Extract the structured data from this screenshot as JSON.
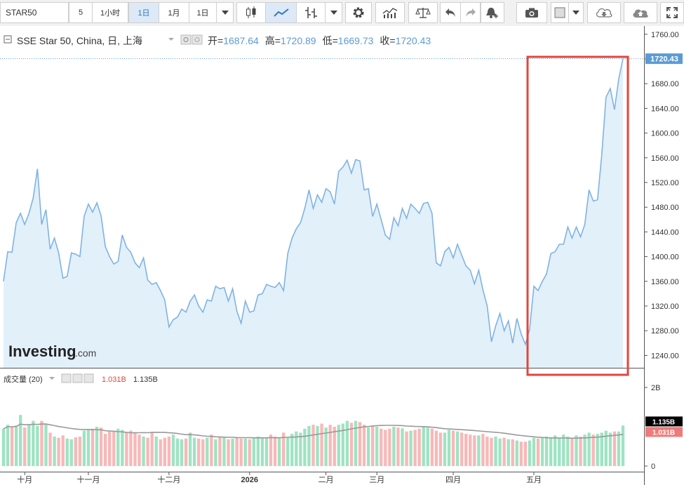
{
  "toolbar": {
    "symbol": "STAR50",
    "interval_value": "5",
    "interval_1h": "1小时",
    "interval_1d": "1日",
    "interval_1m": "1月",
    "range": "1日"
  },
  "legend": {
    "title": "SSE Star 50, China, 日, 上海",
    "open_label": "开=",
    "open_value": "1687.64",
    "high_label": "高=",
    "high_value": "1720.89",
    "low_label": "低=",
    "low_value": "1669.73",
    "close_label": "收=",
    "close_value": "1720.43"
  },
  "volume_legend": {
    "title": "成交量 (20)",
    "volume_value": "1.031B",
    "ma_value": "1.135B"
  },
  "watermark": {
    "brand": "Investing",
    "suffix": ".com"
  },
  "colors": {
    "line": "#7fb3e3",
    "area_fill": "#e2f0fa",
    "price_tag": "#5b9bd5",
    "up_volume": "#9fe3c3",
    "down_volume": "#f8b8b8",
    "ma_line": "#999999",
    "highlight_box": "#e0463e",
    "legend_value": "#5b9bd5"
  },
  "chart_data": {
    "type": "line",
    "title": "SSE Star 50, China, 日, 上海",
    "ylim": [
      1220,
      1770
    ],
    "yticks": [
      "1760.00",
      "1720.00",
      "1680.00",
      "1640.00",
      "1600.00",
      "1560.00",
      "1520.00",
      "1480.00",
      "1440.00",
      "1400.00",
      "1360.00",
      "1320.00",
      "1280.00",
      "1240.00"
    ],
    "ytick_values": [
      1760,
      1720,
      1680,
      1640,
      1600,
      1560,
      1520,
      1480,
      1440,
      1400,
      1360,
      1320,
      1280,
      1240
    ],
    "current_price_label": "1720.43",
    "current_price": 1720.43,
    "xticks": [
      {
        "label": "十月",
        "index": 5
      },
      {
        "label": "十一月",
        "index": 20
      },
      {
        "label": "十二月",
        "index": 39
      },
      {
        "label": "2026",
        "index": 58
      },
      {
        "label": "二月",
        "index": 76
      },
      {
        "label": "三月",
        "index": 88
      },
      {
        "label": "四月",
        "index": 106
      },
      {
        "label": "五月",
        "index": 125
      }
    ],
    "close": [
      1360,
      1408,
      1407,
      1455,
      1470,
      1452,
      1470,
      1495,
      1542,
      1452,
      1476,
      1412,
      1430,
      1406,
      1365,
      1368,
      1406,
      1404,
      1400,
      1465,
      1485,
      1472,
      1487,
      1466,
      1416,
      1400,
      1388,
      1392,
      1435,
      1415,
      1407,
      1390,
      1382,
      1398,
      1362,
      1355,
      1358,
      1345,
      1330,
      1286,
      1298,
      1302,
      1315,
      1310,
      1328,
      1338,
      1320,
      1310,
      1330,
      1328,
      1352,
      1348,
      1350,
      1328,
      1348,
      1312,
      1292,
      1328,
      1310,
      1312,
      1338,
      1340,
      1355,
      1352,
      1350,
      1358,
      1345,
      1405,
      1430,
      1445,
      1455,
      1478,
      1508,
      1478,
      1500,
      1488,
      1510,
      1505,
      1485,
      1538,
      1545,
      1556,
      1535,
      1557,
      1555,
      1508,
      1510,
      1465,
      1485,
      1460,
      1435,
      1428,
      1463,
      1450,
      1478,
      1462,
      1485,
      1478,
      1470,
      1486,
      1488,
      1470,
      1390,
      1385,
      1408,
      1415,
      1398,
      1420,
      1402,
      1385,
      1378,
      1356,
      1378,
      1346,
      1320,
      1262,
      1288,
      1308,
      1280,
      1296,
      1260,
      1300,
      1275,
      1258,
      1282,
      1352,
      1345,
      1360,
      1372,
      1405,
      1408,
      1420,
      1420,
      1448,
      1430,
      1448,
      1432,
      1452,
      1508,
      1490,
      1492,
      1565,
      1658,
      1672,
      1638,
      1688,
      1720.43
    ],
    "volume_bn": [
      0.95,
      1.05,
      1.0,
      1.03,
      1.3,
      0.98,
      1.05,
      1.15,
      1.02,
      1.15,
      1.08,
      0.85,
      0.75,
      0.72,
      0.78,
      0.7,
      0.68,
      0.73,
      0.75,
      0.9,
      0.92,
      0.95,
      1.0,
      0.98,
      0.82,
      0.88,
      0.9,
      0.95,
      0.92,
      0.85,
      0.9,
      0.85,
      0.8,
      0.75,
      0.72,
      0.85,
      0.75,
      0.68,
      0.72,
      0.75,
      0.8,
      0.7,
      0.68,
      0.7,
      0.85,
      0.72,
      0.7,
      0.68,
      0.72,
      0.8,
      0.68,
      0.75,
      0.72,
      0.68,
      0.7,
      0.72,
      0.7,
      0.7,
      0.68,
      0.72,
      0.75,
      0.72,
      0.72,
      0.8,
      0.75,
      0.72,
      0.85,
      0.72,
      0.82,
      0.88,
      0.85,
      0.95,
      1.02,
      1.05,
      1.02,
      1.08,
      0.98,
      1.05,
      1.0,
      1.05,
      1.08,
      1.15,
      1.1,
      1.15,
      1.12,
      1.05,
      0.98,
      1.02,
      1.0,
      0.95,
      0.92,
      0.95,
      1.0,
      0.98,
      0.96,
      0.88,
      0.9,
      0.92,
      0.95,
      1.0,
      0.98,
      0.95,
      0.9,
      0.85,
      0.85,
      0.92,
      0.9,
      0.88,
      0.85,
      0.82,
      0.8,
      0.78,
      0.78,
      0.82,
      0.75,
      0.72,
      0.75,
      0.7,
      0.72,
      0.68,
      0.68,
      0.65,
      0.62,
      0.62,
      0.65,
      0.72,
      0.7,
      0.72,
      0.75,
      0.72,
      0.78,
      0.72,
      0.8,
      0.75,
      0.72,
      0.78,
      0.75,
      0.8,
      0.85,
      0.8,
      0.82,
      0.85,
      0.9,
      0.85,
      0.88,
      0.88,
      1.031
    ],
    "volume_ma_bn": 1.135,
    "volume_yticks": [
      "2B",
      "0"
    ],
    "volume_ytick_values": [
      2,
      0
    ],
    "volume_ma_label": "1.135B",
    "volume_last_label": "1.031B",
    "grid": false
  }
}
